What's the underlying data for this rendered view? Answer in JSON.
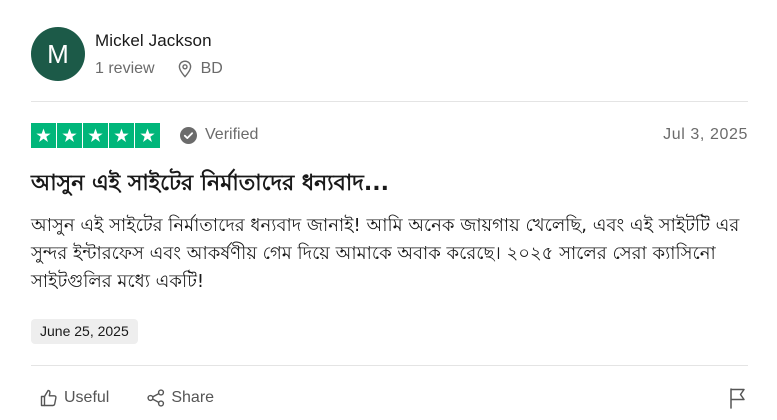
{
  "reviewer": {
    "initial": "M",
    "name": "Mickel Jackson",
    "reviews": "1 review",
    "country": "BD",
    "avatar_color": "#1c5a48"
  },
  "review": {
    "rating": 5,
    "max_rating": 5,
    "star_color": "#00b67a",
    "verified_label": "Verified",
    "date": "Jul 3, 2025",
    "title": "আসুন এই সাইটের নির্মাতাদের ধন্যবাদ...",
    "body": "আসুন এই সাইটের নির্মাতাদের ধন্যবাদ জানাই! আমি অনেক জায়গায় খেলেছি, এবং এই সাইটটি এর সুন্দর ইন্টারফেস এবং আকর্ষণীয় গেম দিয়ে আমাকে অবাক করেছে। ২০২৫ সালের সেরা ক্যাসিনো সাইটগুলির মধ্যে একটি!",
    "experience_date": "June 25, 2025"
  },
  "actions": {
    "useful_label": "Useful",
    "share_label": "Share",
    "useful_icon": "thumbs-up-icon",
    "share_icon": "share-icon",
    "report_icon": "flag-icon"
  }
}
